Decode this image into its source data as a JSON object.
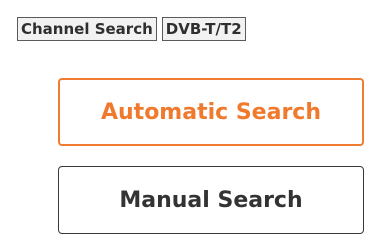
{
  "header": {
    "breadcrumbs": [
      "Channel Search",
      "DVB-T/T2"
    ]
  },
  "menu": {
    "items": [
      {
        "label": "Automatic Search",
        "state": "focused"
      },
      {
        "label": "Manual Search",
        "state": "normal"
      }
    ]
  },
  "colors": {
    "focus_accent": "#f07c32",
    "text_dark": "#333333",
    "background": "#ffffff"
  }
}
